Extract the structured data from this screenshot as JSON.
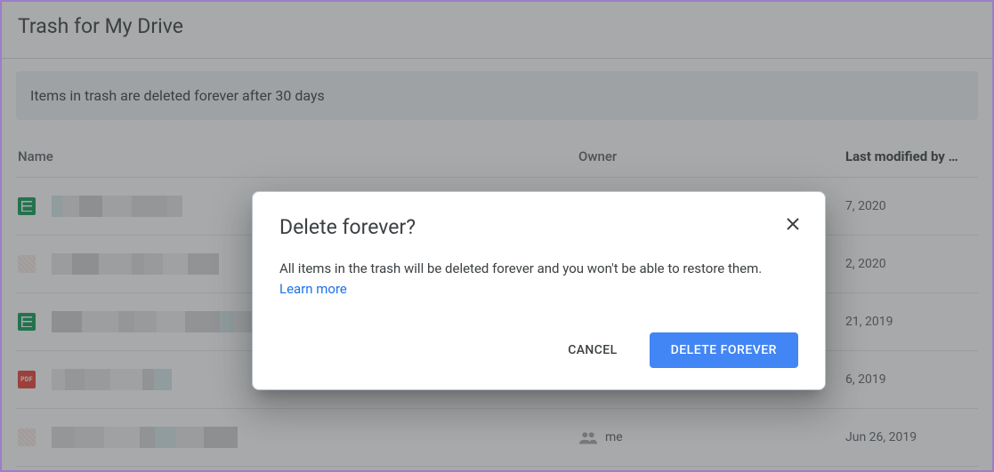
{
  "header": {
    "title": "Trash for My Drive"
  },
  "banner": {
    "text": "Items in trash are deleted forever after 30 days"
  },
  "columns": {
    "name": "Name",
    "owner": "Owner",
    "modified": "Last modified by …"
  },
  "files": [
    {
      "icon": "sheets",
      "owner": "",
      "modified": "7, 2020"
    },
    {
      "icon": "generic",
      "owner": "",
      "modified": "2, 2020"
    },
    {
      "icon": "sheets",
      "owner": "",
      "modified": "21, 2019"
    },
    {
      "icon": "pdf",
      "owner": "",
      "modified": "6, 2019"
    },
    {
      "icon": "generic",
      "owner": "me",
      "modified": "Jun 26, 2019"
    }
  ],
  "dialog": {
    "title": "Delete forever?",
    "body": "All items in the trash will be deleted forever and you won't be able to restore them. ",
    "learn_more": "Learn more",
    "cancel": "CANCEL",
    "confirm": "DELETE FOREVER"
  },
  "icons": {
    "pdf_label": "PDF"
  }
}
